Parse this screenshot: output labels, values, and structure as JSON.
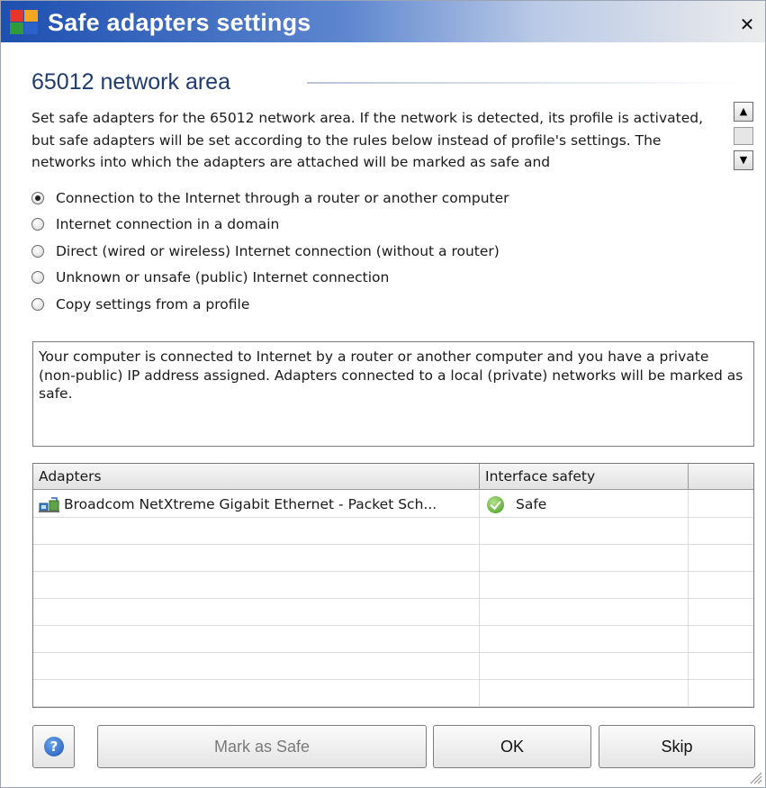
{
  "window": {
    "title": "Safe adapters settings",
    "close_glyph": "✕"
  },
  "header": {
    "title": "65012 network area",
    "description": "Set safe adapters for the 65012 network area. If the network is detected, its profile is activated, but safe adapters will be set according to the rules below instead of profile's settings. The networks into which the adapters are attached will be marked as safe and"
  },
  "scrollbar": {
    "up_glyph": "▲",
    "down_glyph": "▼"
  },
  "radios": [
    {
      "label": "Connection to the Internet through a router or another computer",
      "checked": true
    },
    {
      "label": "Internet connection in a domain",
      "checked": false
    },
    {
      "label": "Direct (wired or wireless) Internet connection (without a router)",
      "checked": false
    },
    {
      "label": "Unknown or unsafe (public) Internet connection",
      "checked": false
    },
    {
      "label": "Copy settings from a profile",
      "checked": false
    }
  ],
  "info_text": "Your computer is connected to Internet by a router or another computer and you have a private (non-public) IP address assigned. Adapters connected to a local (private) networks will be marked as safe.",
  "table": {
    "columns": [
      "Adapters",
      "Interface safety",
      ""
    ],
    "rows": [
      {
        "adapter": "Broadcom NetXtreme Gigabit Ethernet - Packet Sch...",
        "safety": "Safe",
        "icon": "network-adapter-icon",
        "safety_icon": "safe-check-icon"
      }
    ]
  },
  "buttons": {
    "help_glyph": "?",
    "mark_safe": "Mark as Safe",
    "ok": "OK",
    "skip": "Skip"
  },
  "colors": {
    "title_gradient_start": "#1d4fb0",
    "section_title": "#1f3c70",
    "safe_green": "#3f9a1c"
  }
}
